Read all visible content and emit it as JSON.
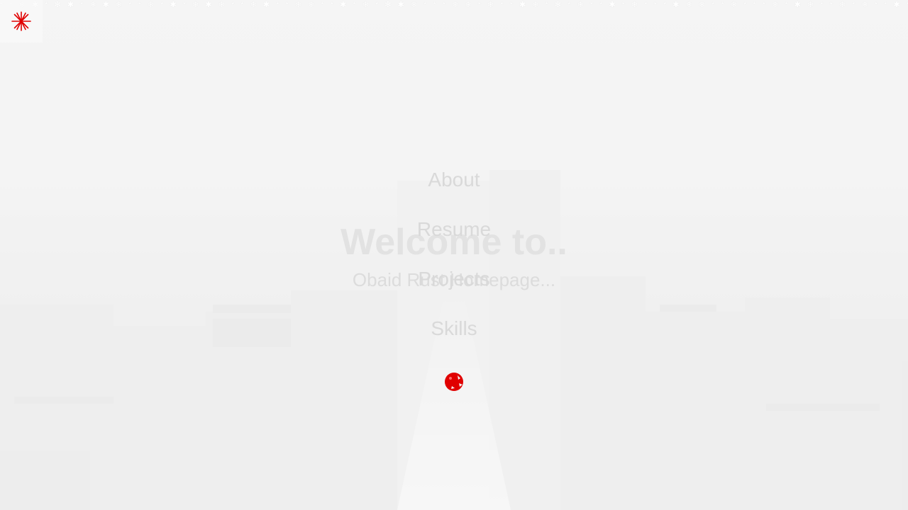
{
  "colors": {
    "accent": "#e00000",
    "title_text": "#e2e2e2",
    "nav_text": "#d9d9d9",
    "background": "#efefef"
  },
  "header": {
    "menu_icon": "snowflake-icon",
    "snow_strip": "* * ❄ ✱ * ✻ ✱ * ❄ ✱ ❄ * * ❄ * ✱ * ❄ ✱ ❄ * * ❄ ✱ * * ❄ ❄ * * ✱ * ❄ * ✻ ✱ ❄ * * * ❄ ❄ * ❄ * * ✱ ❄ * ✻ * ❄ * * ✱ * ❄ * * * ✱ ❄ ❄ * * ❄ * * * ❄ * ✱ ❄ *   * ❄ * ❄ * * ✱ * * *"
  },
  "hero": {
    "title": "Welcome to..",
    "subtitle": "Obaid Rust Homepage..."
  },
  "nav": {
    "items": [
      {
        "label": "About"
      },
      {
        "label": "Resume"
      },
      {
        "label": "Projects"
      },
      {
        "label": "Skills"
      }
    ],
    "close_icon": "red-ornament-icon"
  }
}
